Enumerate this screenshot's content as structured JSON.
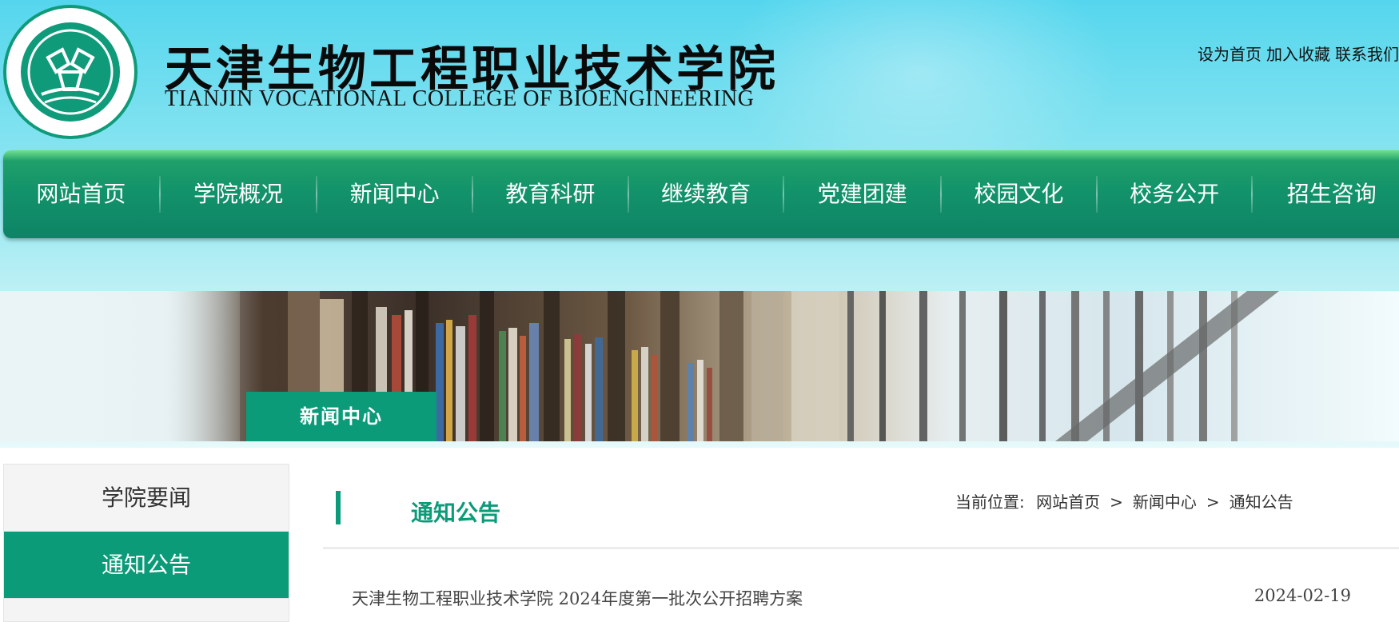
{
  "header": {
    "title_cn": "天津生物工程职业技术学院",
    "title_en": "TIANJIN VOCATIONAL COLLEGE OF BIOENGINEERING",
    "top_links": [
      "设为首页",
      "加入收藏",
      "联系我们"
    ]
  },
  "nav": {
    "items": [
      "网站首页",
      "学院概况",
      "新闻中心",
      "教育科研",
      "继续教育",
      "党建团建",
      "校园文化",
      "校务公开",
      "招生咨询"
    ]
  },
  "banner": {
    "section_label": "新闻中心"
  },
  "sidebar": {
    "items": [
      {
        "label": "学院要闻",
        "active": false
      },
      {
        "label": "通知公告",
        "active": true
      }
    ]
  },
  "main": {
    "title": "通知公告",
    "breadcrumb": {
      "prefix": "当前位置:",
      "items": [
        "网站首页",
        "新闻中心",
        "通知公告"
      ],
      "separator": ">"
    },
    "list": [
      {
        "title": "天津生物工程职业技术学院 2024年度第一批次公开招聘方案",
        "date": "2024-02-19"
      }
    ]
  },
  "colors": {
    "accent": "#0c9b79",
    "nav_bg": "#13936a",
    "header_sky": "#55d6ee"
  }
}
